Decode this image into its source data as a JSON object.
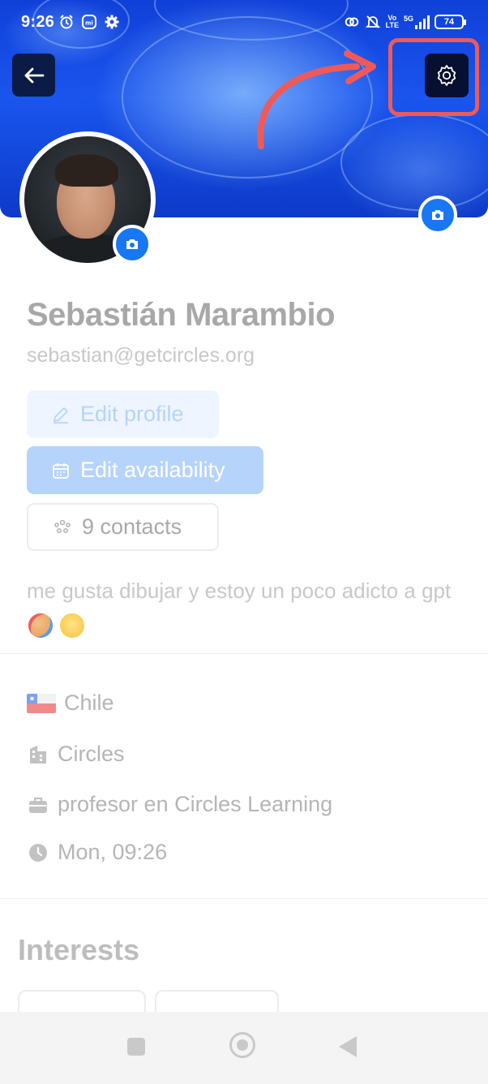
{
  "status_bar": {
    "time": "9:26",
    "battery": "74",
    "network": "5G",
    "volte": "Vo\nLTE",
    "left_icons": [
      "alarm-icon",
      "mi-icon",
      "gear-icon"
    ],
    "right_icons": [
      "hotspot-icon",
      "mute-icon",
      "volte-icon",
      "signal-icon",
      "battery-icon"
    ]
  },
  "header": {
    "back_icon": "arrow-left-icon",
    "settings_icon": "gear-icon"
  },
  "profile": {
    "name": "Sebastián Marambio",
    "email": "sebastian@getcircles.org",
    "edit_profile_label": "Edit profile",
    "edit_availability_label": "Edit availability",
    "contacts_label": "9 contacts",
    "bio": "me gusta dibujar y estoy un poco adicto a gpt"
  },
  "details": {
    "country": "Chile",
    "organization": "Circles",
    "role": "profesor en Circles Learning",
    "local_time": "Mon, 09:26"
  },
  "interests": {
    "title": "Interests"
  },
  "colors": {
    "accent": "#1877f2",
    "highlight": "#ee5a5a",
    "cover": "#1a55ee"
  }
}
